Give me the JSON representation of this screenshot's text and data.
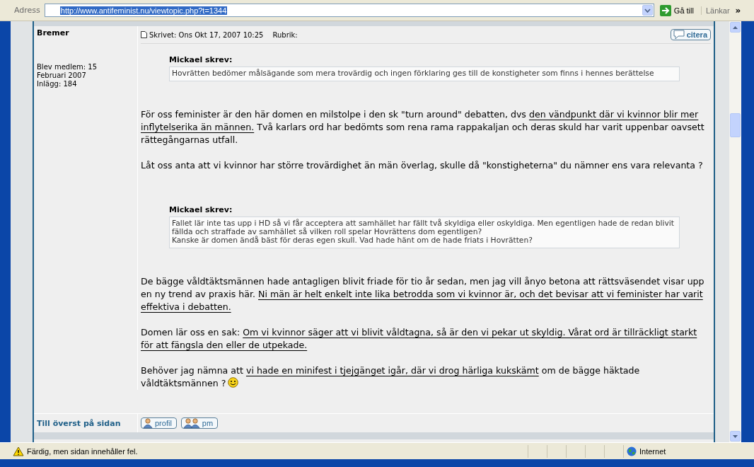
{
  "address_bar": {
    "label": "Adress",
    "url": "http://www.antifeminist.nu/viewtopic.php?t=1344",
    "url_selected": true,
    "go_button": "Gå till",
    "links": "Länkar",
    "more": "»"
  },
  "post": {
    "author": "Bremer",
    "member_info": [
      "Blev medlem: 15",
      "Februari 2007",
      "Inlägg: 184"
    ],
    "posted": "Skrivet: Ons Okt 17, 2007 10:25",
    "subject_label": "Rubrik:",
    "quote_button": "citera",
    "blocks": [
      {
        "kind": "quote",
        "author": "Mickael skrev:",
        "lines": [
          "Hovrätten bedömer målsägande som mera trovärdig och ingen förklaring ges till de konstigheter som finns i hennes berättelse"
        ]
      },
      {
        "kind": "paragraph",
        "smiley": false,
        "segments": [
          {
            "text": "För oss feminister är den här domen en milstolpe i den sk \"turn around\" debatten, dvs ",
            "underlined": false
          },
          {
            "text": "den vändpunkt där vi kvinnor blir mer inflytelserika än männen.",
            "underlined": true
          },
          {
            "text": " Två karlars ord har bedömts som rena rama rappakaljan och deras skuld har varit uppenbar oavsett rättegångarnas utfall.",
            "underlined": false
          }
        ]
      },
      {
        "kind": "paragraph",
        "smiley": false,
        "segments": [
          {
            "text": "Låt oss anta att vi kvinnor har större trovärdighet än män överlag, skulle då \"konstigheterna\" du nämner ens vara relevanta ?",
            "underlined": false
          }
        ]
      },
      {
        "kind": "quote",
        "author": "Mickael skrev:",
        "lines": [
          "Fallet lär inte tas upp i HD så vi får acceptera att samhället har fällt två skyldiga eller oskyldiga. Men egentligen hade de redan blivit fällda och straffade av samhället så vilken roll spelar Hovrättens dom egentligen?",
          "Kanske är domen ändå bäst för deras egen skull. Vad hade hänt om de hade friats i Hovrätten?"
        ]
      },
      {
        "kind": "paragraph",
        "smiley": false,
        "segments": [
          {
            "text": "De bägge våldtäktsmännen hade antagligen blivit friade för tio år sedan, men jag vill ånyo betona att rättsväsendet visar upp en ny trend av praxis här. ",
            "underlined": false
          },
          {
            "text": "Ni män är helt enkelt inte lika betrodda som vi kvinnor är, och det bevisar att vi feminister har varit effektiva i debatten.",
            "underlined": true
          }
        ]
      },
      {
        "kind": "paragraph",
        "smiley": false,
        "segments": [
          {
            "text": "Domen lär oss en sak: ",
            "underlined": false
          },
          {
            "text": "Om vi kvinnor säger att vi blivit våldtagna, så är den vi pekar ut skyldig. Vårat ord är tillräckligt starkt för att fängsla den eller de utpekade.",
            "underlined": true
          }
        ]
      },
      {
        "kind": "paragraph",
        "smiley": true,
        "segments": [
          {
            "text": "Behöver jag nämna att ",
            "underlined": false
          },
          {
            "text": "vi hade en minifest i tjejgänget igår, där vi drog härliga kukskämt",
            "underlined": true
          },
          {
            "text": " om de bägge häktade våldtäktsmännen ?",
            "underlined": false
          }
        ]
      }
    ],
    "back_to_top": "Till överst på sidan",
    "buttons": [
      "profil",
      "pm"
    ]
  },
  "status_bar": {
    "message": "Färdig, men sidan innehåller fel.",
    "zone": "Internet"
  }
}
